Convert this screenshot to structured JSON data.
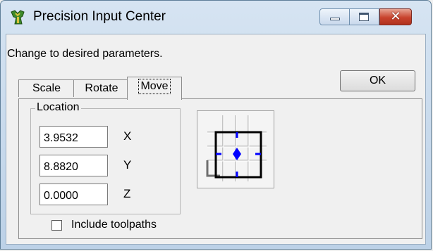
{
  "window": {
    "title": "Precision Input Center",
    "icon": "app-logo-icon",
    "controls": [
      "minimize-icon",
      "maximize-icon",
      "close-icon"
    ]
  },
  "instructions": "Change to desired parameters.",
  "tabs": [
    {
      "label": "Scale",
      "active": false
    },
    {
      "label": "Rotate",
      "active": false
    },
    {
      "label": "Move",
      "active": true
    }
  ],
  "ok_label": "OK",
  "location": {
    "title": "Location",
    "x": {
      "label": "X",
      "value": "3.9532"
    },
    "y": {
      "label": "Y",
      "value": "8.8820"
    },
    "z": {
      "label": "Z",
      "value": "0.0000"
    }
  },
  "include_toolpaths": {
    "label": "Include toolpaths",
    "checked": false
  },
  "anchor_picker": {
    "icon": "anchor-grid-icon",
    "marker_color": "#0000ff"
  }
}
